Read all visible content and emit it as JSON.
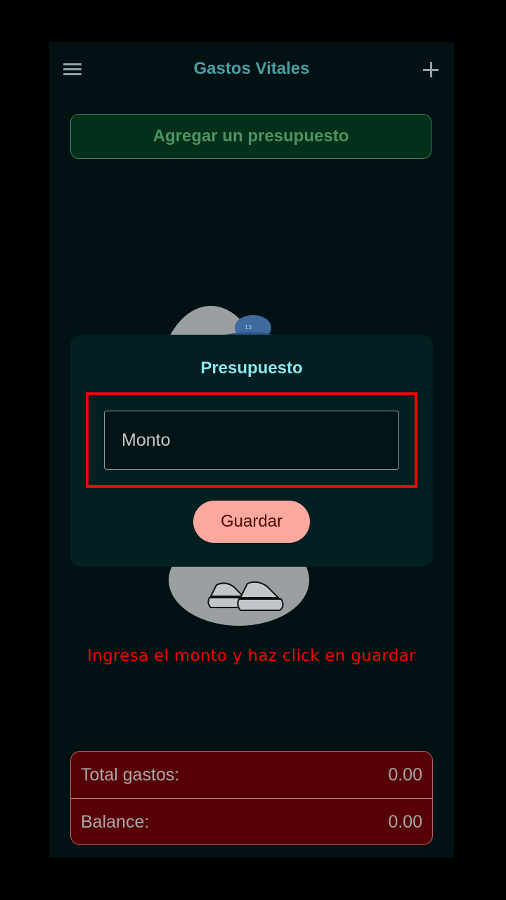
{
  "header": {
    "title": "Gastos Vitales",
    "menu_icon": "hamburger-menu-icon",
    "add_icon": "plus-icon"
  },
  "add_budget": {
    "label": "Agregar un presupuesto"
  },
  "dialog": {
    "title": "Presupuesto",
    "amount_placeholder": "Monto",
    "amount_value": "",
    "save_label": "Guardar"
  },
  "instruction": "Ingresa el monto y haz click en guardar",
  "summary": {
    "rows": [
      {
        "label": "Total gastos:",
        "value": "0.00"
      },
      {
        "label": "Balance:",
        "value": "0.00"
      }
    ]
  },
  "colors": {
    "background": "#021114",
    "title": "#4a9fa3",
    "add_budget_bg": "#03301a",
    "dialog_bg": "#021f22",
    "dialog_title": "#8be6ec",
    "save_bg": "#fda89f",
    "highlight": "#ff0000",
    "summary_bg": "#570006"
  }
}
